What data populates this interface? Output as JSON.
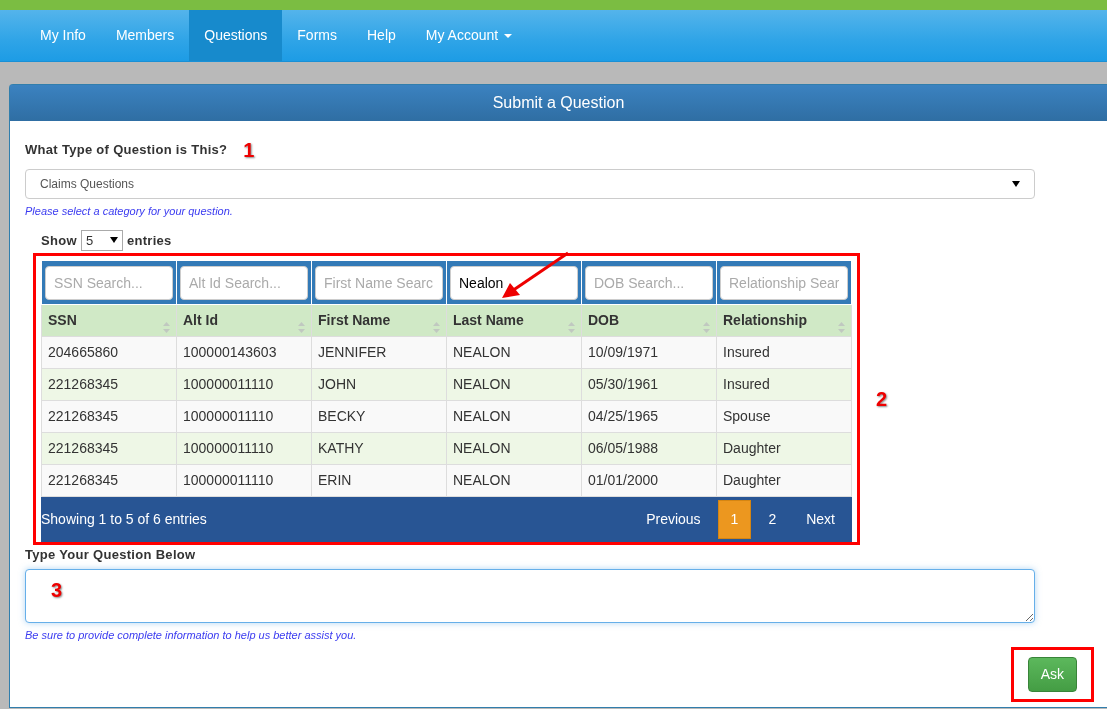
{
  "nav": [
    {
      "label": "My Info",
      "selected": false,
      "dropdown": false
    },
    {
      "label": "Members",
      "selected": false,
      "dropdown": false
    },
    {
      "label": "Questions",
      "selected": true,
      "dropdown": false
    },
    {
      "label": "Forms",
      "selected": false,
      "dropdown": false
    },
    {
      "label": "Help",
      "selected": false,
      "dropdown": false
    },
    {
      "label": "My Account",
      "selected": false,
      "dropdown": true
    }
  ],
  "panel": {
    "title": "Submit a Question"
  },
  "question_type": {
    "label": "What Type of Question is This?",
    "value": "Claims Questions",
    "hint": "Please select a category for your question."
  },
  "table": {
    "length_label_before": "Show",
    "length_value": "5",
    "length_label_after": "entries",
    "filters": [
      {
        "placeholder": "SSN Search..."
      },
      {
        "placeholder": "Alt Id Search..."
      },
      {
        "placeholder": "First Name Searc"
      },
      {
        "value": "Nealon"
      },
      {
        "placeholder": "DOB Search..."
      },
      {
        "placeholder": "Relationship Sear"
      }
    ],
    "columns": [
      "SSN",
      "Alt Id",
      "First Name",
      "Last Name",
      "DOB",
      "Relationship"
    ],
    "rows": [
      [
        "204665860",
        "100000143603",
        "JENNIFER",
        "NEALON",
        "10/09/1971",
        "Insured"
      ],
      [
        "221268345",
        "100000011110",
        "JOHN",
        "NEALON",
        "05/30/1961",
        "Insured"
      ],
      [
        "221268345",
        "100000011110",
        "BECKY",
        "NEALON",
        "04/25/1965",
        "Spouse"
      ],
      [
        "221268345",
        "100000011110",
        "KATHY",
        "NEALON",
        "06/05/1988",
        "Daughter"
      ],
      [
        "221268345",
        "100000011110",
        "ERIN",
        "NEALON",
        "01/01/2000",
        "Daughter"
      ]
    ],
    "info": "Showing 1 to 5 of 6 entries",
    "pages": [
      {
        "label": "Previous",
        "selected": false
      },
      {
        "label": "1",
        "selected": true
      },
      {
        "label": "2",
        "selected": false
      },
      {
        "label": "Next",
        "selected": false
      }
    ]
  },
  "question": {
    "label": "Type Your Question Below",
    "hint": "Be sure to provide complete information to help us better assist you."
  },
  "ask_button": "Ask",
  "annotations": [
    "1",
    "2",
    "3"
  ]
}
